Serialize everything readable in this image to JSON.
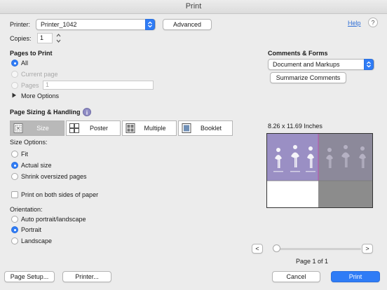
{
  "window": {
    "title": "Print"
  },
  "printer": {
    "label": "Printer:",
    "value": "Printer_1042",
    "advanced_label": "Advanced",
    "help_label": "Help"
  },
  "copies": {
    "label": "Copies:",
    "value": "1"
  },
  "pages_to_print": {
    "heading": "Pages to Print",
    "all_label": "All",
    "current_label": "Current page",
    "pages_label": "Pages",
    "pages_value": "1",
    "more_options_label": "More Options"
  },
  "sizing": {
    "heading": "Page Sizing & Handling",
    "modes": [
      {
        "label": "Size",
        "active": true
      },
      {
        "label": "Poster",
        "active": false
      },
      {
        "label": "Multiple",
        "active": false
      },
      {
        "label": "Booklet",
        "active": false
      }
    ],
    "size_options_label": "Size Options:",
    "fit_label": "Fit",
    "actual_label": "Actual size",
    "shrink_label": "Shrink oversized pages",
    "both_sides_label": "Print on both sides of paper"
  },
  "orientation": {
    "label": "Orientation:",
    "auto_label": "Auto portrait/landscape",
    "portrait_label": "Portrait",
    "landscape_label": "Landscape"
  },
  "comments": {
    "heading": "Comments & Forms",
    "value": "Document and Markups",
    "summarize_label": "Summarize Comments"
  },
  "preview": {
    "paper_size": "8.26 x 11.69 Inches",
    "page_indicator": "Page 1 of 1",
    "prev_label": "<",
    "next_label": ">"
  },
  "footer": {
    "page_setup_label": "Page Setup...",
    "printer_label": "Printer...",
    "cancel_label": "Cancel",
    "print_label": "Print"
  },
  "colors": {
    "accent": "#2f7cf6",
    "preview_purple": "#9a8fc4",
    "preview_gray": "#8c8c8c"
  }
}
